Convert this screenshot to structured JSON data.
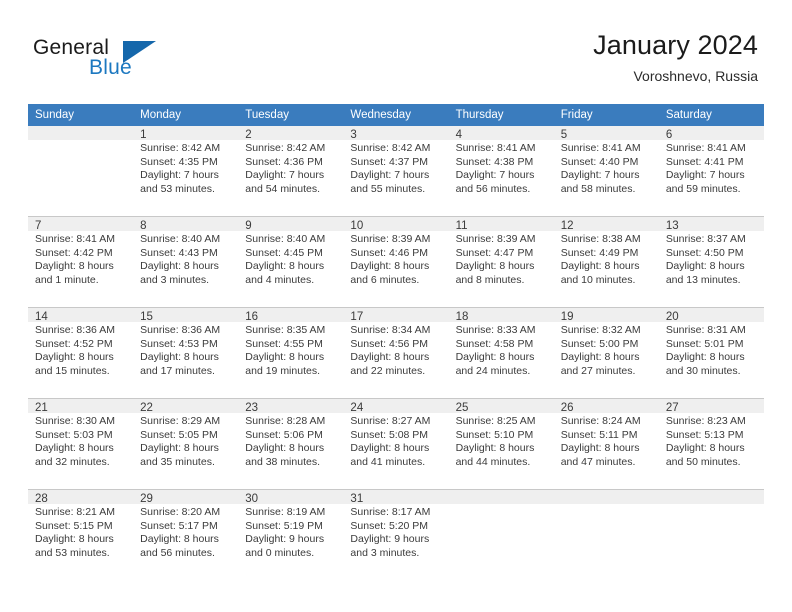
{
  "brand": {
    "name_part1": "General",
    "name_part2": "Blue",
    "accent_color": "#1c78c0",
    "flag_color": "#1567ab"
  },
  "header": {
    "title": "January 2024",
    "subtitle": "Voroshnevo, Russia"
  },
  "calendar": {
    "header_bg": "#3a7cbe",
    "weekdays": [
      "Sunday",
      "Monday",
      "Tuesday",
      "Wednesday",
      "Thursday",
      "Friday",
      "Saturday"
    ],
    "weeks": [
      [
        {
          "day": "",
          "l1": "",
          "l2": "",
          "l3": "",
          "l4": ""
        },
        {
          "day": "1",
          "l1": "Sunrise: 8:42 AM",
          "l2": "Sunset: 4:35 PM",
          "l3": "Daylight: 7 hours",
          "l4": "and 53 minutes."
        },
        {
          "day": "2",
          "l1": "Sunrise: 8:42 AM",
          "l2": "Sunset: 4:36 PM",
          "l3": "Daylight: 7 hours",
          "l4": "and 54 minutes."
        },
        {
          "day": "3",
          "l1": "Sunrise: 8:42 AM",
          "l2": "Sunset: 4:37 PM",
          "l3": "Daylight: 7 hours",
          "l4": "and 55 minutes."
        },
        {
          "day": "4",
          "l1": "Sunrise: 8:41 AM",
          "l2": "Sunset: 4:38 PM",
          "l3": "Daylight: 7 hours",
          "l4": "and 56 minutes."
        },
        {
          "day": "5",
          "l1": "Sunrise: 8:41 AM",
          "l2": "Sunset: 4:40 PM",
          "l3": "Daylight: 7 hours",
          "l4": "and 58 minutes."
        },
        {
          "day": "6",
          "l1": "Sunrise: 8:41 AM",
          "l2": "Sunset: 4:41 PM",
          "l3": "Daylight: 7 hours",
          "l4": "and 59 minutes."
        }
      ],
      [
        {
          "day": "7",
          "l1": "Sunrise: 8:41 AM",
          "l2": "Sunset: 4:42 PM",
          "l3": "Daylight: 8 hours",
          "l4": "and 1 minute."
        },
        {
          "day": "8",
          "l1": "Sunrise: 8:40 AM",
          "l2": "Sunset: 4:43 PM",
          "l3": "Daylight: 8 hours",
          "l4": "and 3 minutes."
        },
        {
          "day": "9",
          "l1": "Sunrise: 8:40 AM",
          "l2": "Sunset: 4:45 PM",
          "l3": "Daylight: 8 hours",
          "l4": "and 4 minutes."
        },
        {
          "day": "10",
          "l1": "Sunrise: 8:39 AM",
          "l2": "Sunset: 4:46 PM",
          "l3": "Daylight: 8 hours",
          "l4": "and 6 minutes."
        },
        {
          "day": "11",
          "l1": "Sunrise: 8:39 AM",
          "l2": "Sunset: 4:47 PM",
          "l3": "Daylight: 8 hours",
          "l4": "and 8 minutes."
        },
        {
          "day": "12",
          "l1": "Sunrise: 8:38 AM",
          "l2": "Sunset: 4:49 PM",
          "l3": "Daylight: 8 hours",
          "l4": "and 10 minutes."
        },
        {
          "day": "13",
          "l1": "Sunrise: 8:37 AM",
          "l2": "Sunset: 4:50 PM",
          "l3": "Daylight: 8 hours",
          "l4": "and 13 minutes."
        }
      ],
      [
        {
          "day": "14",
          "l1": "Sunrise: 8:36 AM",
          "l2": "Sunset: 4:52 PM",
          "l3": "Daylight: 8 hours",
          "l4": "and 15 minutes."
        },
        {
          "day": "15",
          "l1": "Sunrise: 8:36 AM",
          "l2": "Sunset: 4:53 PM",
          "l3": "Daylight: 8 hours",
          "l4": "and 17 minutes."
        },
        {
          "day": "16",
          "l1": "Sunrise: 8:35 AM",
          "l2": "Sunset: 4:55 PM",
          "l3": "Daylight: 8 hours",
          "l4": "and 19 minutes."
        },
        {
          "day": "17",
          "l1": "Sunrise: 8:34 AM",
          "l2": "Sunset: 4:56 PM",
          "l3": "Daylight: 8 hours",
          "l4": "and 22 minutes."
        },
        {
          "day": "18",
          "l1": "Sunrise: 8:33 AM",
          "l2": "Sunset: 4:58 PM",
          "l3": "Daylight: 8 hours",
          "l4": "and 24 minutes."
        },
        {
          "day": "19",
          "l1": "Sunrise: 8:32 AM",
          "l2": "Sunset: 5:00 PM",
          "l3": "Daylight: 8 hours",
          "l4": "and 27 minutes."
        },
        {
          "day": "20",
          "l1": "Sunrise: 8:31 AM",
          "l2": "Sunset: 5:01 PM",
          "l3": "Daylight: 8 hours",
          "l4": "and 30 minutes."
        }
      ],
      [
        {
          "day": "21",
          "l1": "Sunrise: 8:30 AM",
          "l2": "Sunset: 5:03 PM",
          "l3": "Daylight: 8 hours",
          "l4": "and 32 minutes."
        },
        {
          "day": "22",
          "l1": "Sunrise: 8:29 AM",
          "l2": "Sunset: 5:05 PM",
          "l3": "Daylight: 8 hours",
          "l4": "and 35 minutes."
        },
        {
          "day": "23",
          "l1": "Sunrise: 8:28 AM",
          "l2": "Sunset: 5:06 PM",
          "l3": "Daylight: 8 hours",
          "l4": "and 38 minutes."
        },
        {
          "day": "24",
          "l1": "Sunrise: 8:27 AM",
          "l2": "Sunset: 5:08 PM",
          "l3": "Daylight: 8 hours",
          "l4": "and 41 minutes."
        },
        {
          "day": "25",
          "l1": "Sunrise: 8:25 AM",
          "l2": "Sunset: 5:10 PM",
          "l3": "Daylight: 8 hours",
          "l4": "and 44 minutes."
        },
        {
          "day": "26",
          "l1": "Sunrise: 8:24 AM",
          "l2": "Sunset: 5:11 PM",
          "l3": "Daylight: 8 hours",
          "l4": "and 47 minutes."
        },
        {
          "day": "27",
          "l1": "Sunrise: 8:23 AM",
          "l2": "Sunset: 5:13 PM",
          "l3": "Daylight: 8 hours",
          "l4": "and 50 minutes."
        }
      ],
      [
        {
          "day": "28",
          "l1": "Sunrise: 8:21 AM",
          "l2": "Sunset: 5:15 PM",
          "l3": "Daylight: 8 hours",
          "l4": "and 53 minutes."
        },
        {
          "day": "29",
          "l1": "Sunrise: 8:20 AM",
          "l2": "Sunset: 5:17 PM",
          "l3": "Daylight: 8 hours",
          "l4": "and 56 minutes."
        },
        {
          "day": "30",
          "l1": "Sunrise: 8:19 AM",
          "l2": "Sunset: 5:19 PM",
          "l3": "Daylight: 9 hours",
          "l4": "and 0 minutes."
        },
        {
          "day": "31",
          "l1": "Sunrise: 8:17 AM",
          "l2": "Sunset: 5:20 PM",
          "l3": "Daylight: 9 hours",
          "l4": "and 3 minutes."
        },
        {
          "day": "",
          "l1": "",
          "l2": "",
          "l3": "",
          "l4": ""
        },
        {
          "day": "",
          "l1": "",
          "l2": "",
          "l3": "",
          "l4": ""
        },
        {
          "day": "",
          "l1": "",
          "l2": "",
          "l3": "",
          "l4": ""
        }
      ]
    ]
  }
}
